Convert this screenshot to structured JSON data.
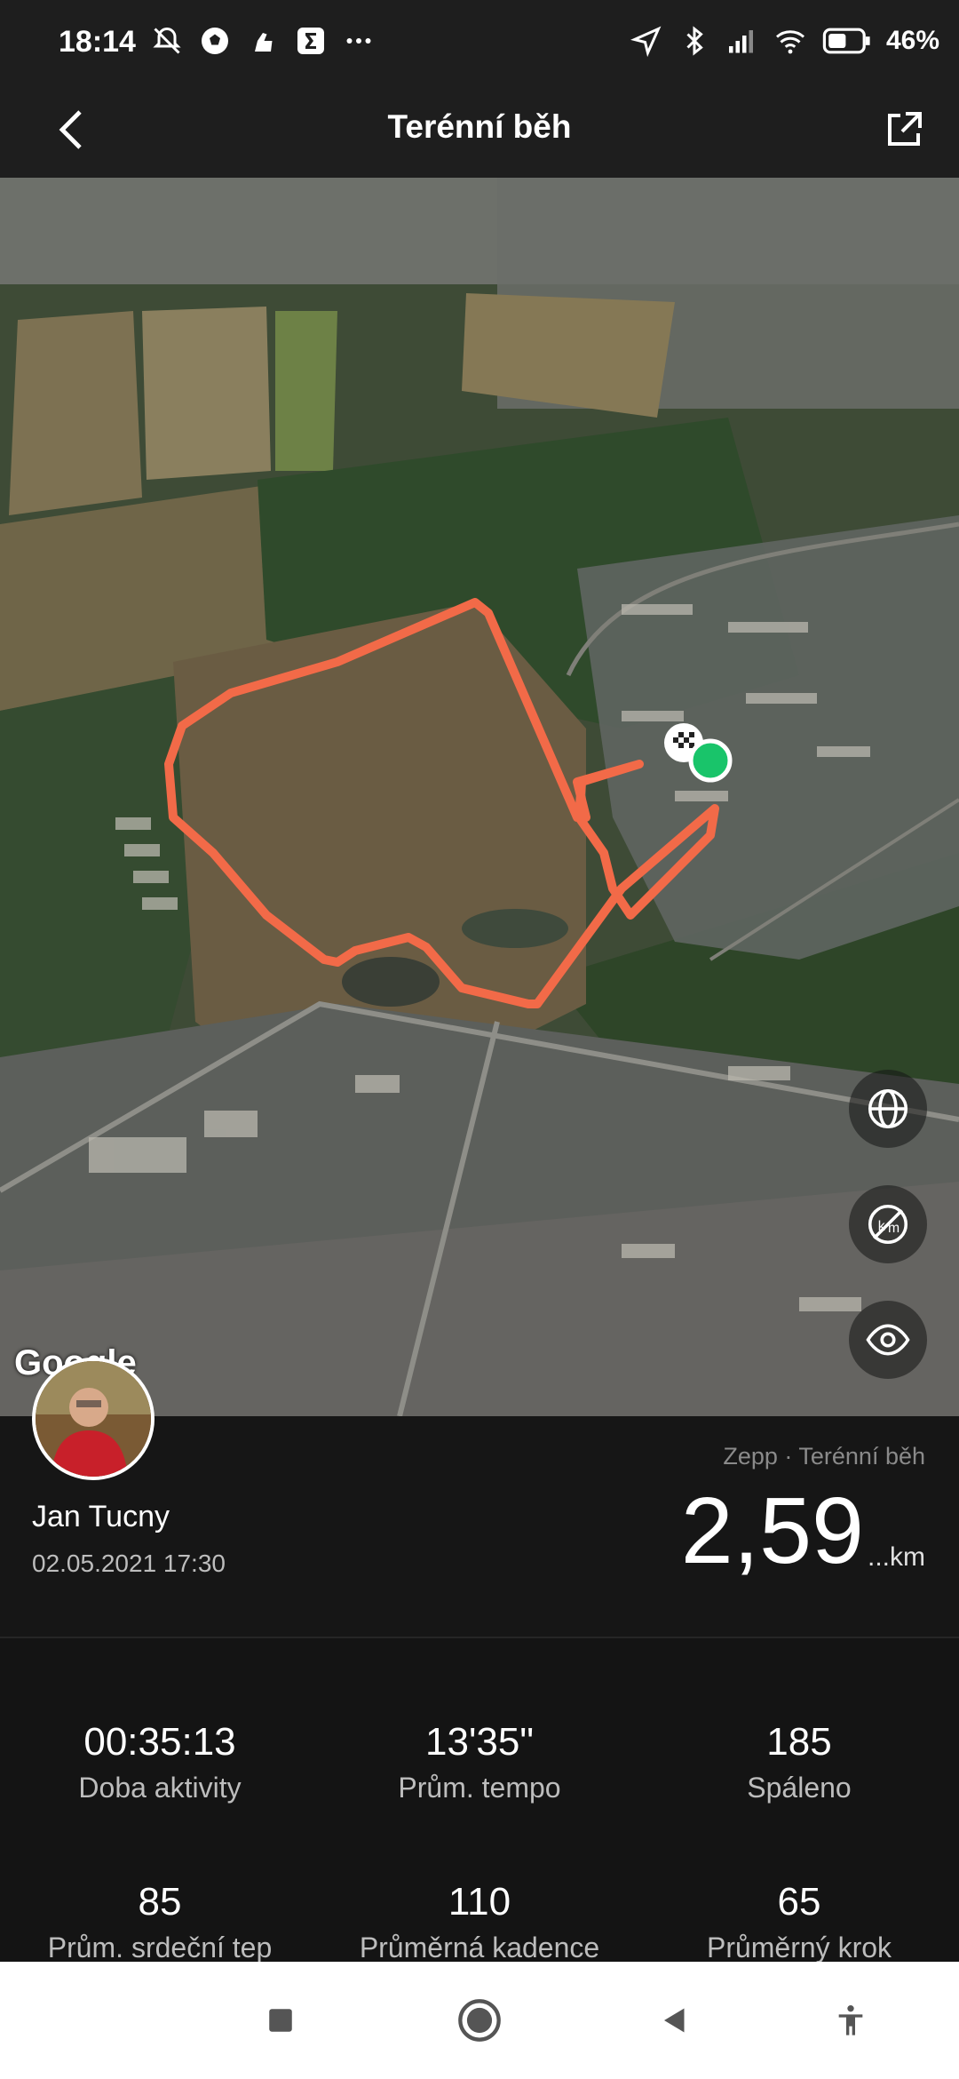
{
  "status_bar": {
    "time": "18:14",
    "battery_text": "46%",
    "icons": [
      "mute-bell-icon",
      "soccer-icon",
      "hand-icon",
      "sigma-app-icon",
      "more-dots-icon",
      "navigation-arrow-icon",
      "bluetooth-icon",
      "signal-bars-icon",
      "wifi-icon",
      "battery-icon"
    ]
  },
  "app_bar": {
    "title": "Terénní běh",
    "back_icon": "chevron-left-icon",
    "share_icon": "share-external-icon"
  },
  "map": {
    "attribution": "Google",
    "buttons": [
      "globe-icon",
      "kilometer-markers-off-icon",
      "eye-icon"
    ],
    "route_color": "#f26a48",
    "end_marker_color": "#19c46a"
  },
  "summary": {
    "user_name": "Jan Tucny",
    "date": "02.05.2021 17:30",
    "source": "Zepp · Terénní běh",
    "distance": "2,59",
    "distance_unit": "...km"
  },
  "stats": [
    {
      "value": "00:35:13",
      "label": "Doba aktivity"
    },
    {
      "value": "13'35\"",
      "label": "Prům. tempo"
    },
    {
      "value": "185",
      "label": "Spáleno"
    },
    {
      "value": "85",
      "label": "Prům. srdeční tep"
    },
    {
      "value": "110",
      "label": "Průměrná kadence"
    },
    {
      "value": "65",
      "label": "Průměrný krok"
    }
  ],
  "nav_bar": {
    "icons": [
      "recents-square-icon",
      "home-circle-icon",
      "back-triangle-icon",
      "accessibility-icon"
    ]
  }
}
